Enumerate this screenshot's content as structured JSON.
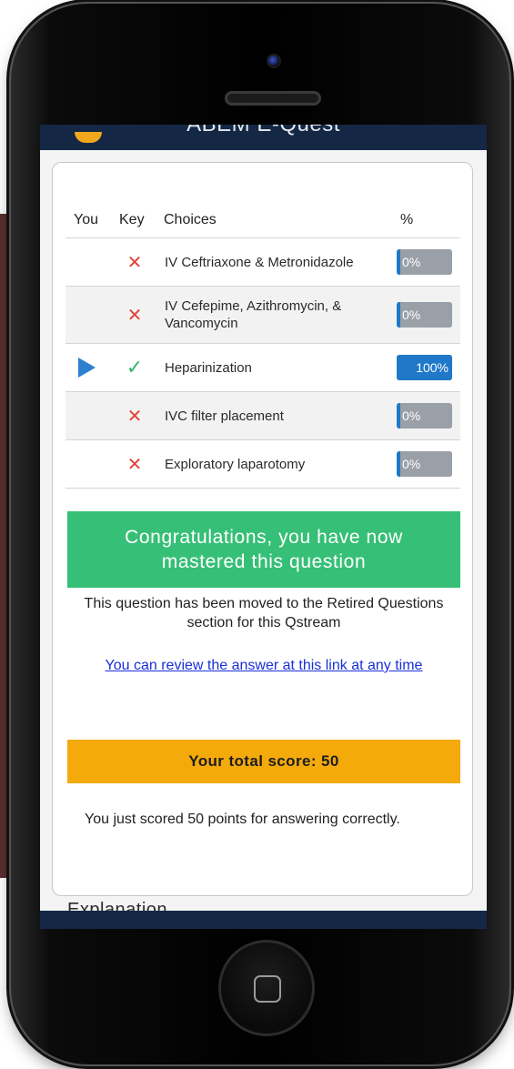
{
  "header": {
    "title": "ABEM E-Quest"
  },
  "table": {
    "headers": {
      "you": "You",
      "key": "Key",
      "choices": "Choices",
      "percent": "%"
    },
    "rows": [
      {
        "choice": "IV Ceftriaxone & Metronidazole",
        "key_icon": "x-icon",
        "key_mark": "✕",
        "selected": false,
        "percent_label": "0%",
        "percent": 0
      },
      {
        "choice": "IV Cefepime, Azithromycin, & Vancomycin",
        "key_icon": "x-icon",
        "key_mark": "✕",
        "selected": false,
        "percent_label": "0%",
        "percent": 0
      },
      {
        "choice": "Heparinization",
        "key_icon": "check-icon",
        "key_mark": "✓",
        "selected": true,
        "percent_label": "100%",
        "percent": 100
      },
      {
        "choice": "IVC filter placement",
        "key_icon": "x-icon",
        "key_mark": "✕",
        "selected": false,
        "percent_label": "0%",
        "percent": 0
      },
      {
        "choice": "Exploratory laparotomy",
        "key_icon": "x-icon",
        "key_mark": "✕",
        "selected": false,
        "percent_label": "0%",
        "percent": 0
      }
    ]
  },
  "result": {
    "congrats": "Congratulations, you have now mastered this question",
    "moved": "This question has been moved to the Retired Questions section for this Qstream",
    "review_link": "You can review the answer at this link at any time",
    "score_banner": "Your total score: 50",
    "score_message": "You just scored 50 points for answering correctly."
  },
  "explanation": {
    "heading": "Explanation"
  },
  "colors": {
    "navbar": "#142845",
    "bar_fill": "#1f78c8",
    "bar_track": "#9aa0a8",
    "congrats": "#36bf76",
    "score": "#f4aa0b",
    "wrong": "#e0443a",
    "correct": "#34b56d",
    "link": "#1a2fd8"
  }
}
